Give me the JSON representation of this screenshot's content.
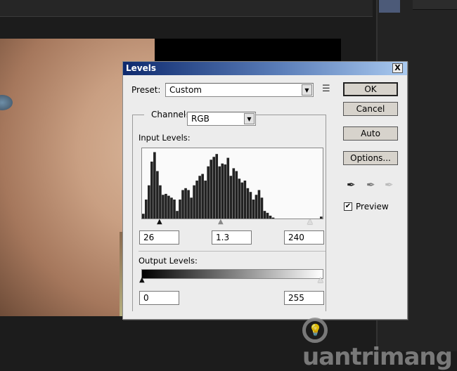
{
  "dialog": {
    "title": "Levels",
    "close_label": "X",
    "preset": {
      "label": "Preset:",
      "value": "Custom"
    },
    "channel": {
      "label": "Channel:",
      "value": "RGB"
    },
    "input_levels": {
      "label": "Input Levels:",
      "black": "26",
      "gamma": "1.3",
      "white": "240"
    },
    "output_levels": {
      "label": "Output Levels:",
      "black": "0",
      "white": "255"
    },
    "buttons": {
      "ok": "OK",
      "cancel": "Cancel",
      "auto": "Auto",
      "options": "Options..."
    },
    "preview": {
      "label": "Preview",
      "checked": true
    },
    "histogram": [
      5,
      20,
      35,
      60,
      70,
      50,
      35,
      25,
      26,
      24,
      22,
      20,
      8,
      20,
      30,
      32,
      30,
      22,
      35,
      40,
      45,
      47,
      40,
      55,
      62,
      65,
      68,
      55,
      58,
      57,
      64,
      45,
      53,
      50,
      42,
      38,
      40,
      32,
      28,
      20,
      25,
      30,
      22,
      8,
      6,
      3,
      1,
      0,
      0,
      0,
      0,
      0,
      0,
      0,
      0,
      0,
      0,
      0,
      0,
      0,
      0,
      0,
      0,
      2
    ]
  },
  "watermark": "uantrimang"
}
